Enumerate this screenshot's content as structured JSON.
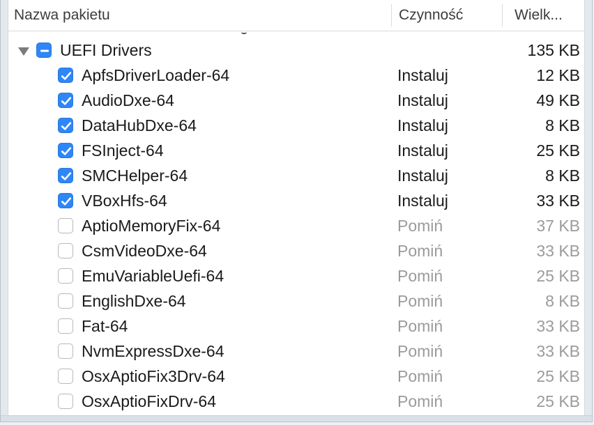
{
  "header": {
    "col_name": "Nazwa pakietu",
    "col_action": "Czynność",
    "col_size": "Wielk..."
  },
  "group": {
    "name": "UEFI Drivers",
    "size": "135 KB",
    "state": "mixed"
  },
  "items": [
    {
      "name": "ApfsDriverLoader-64",
      "action": "Instaluj",
      "size": "12 KB",
      "checked": true
    },
    {
      "name": "AudioDxe-64",
      "action": "Instaluj",
      "size": "49 KB",
      "checked": true
    },
    {
      "name": "DataHubDxe-64",
      "action": "Instaluj",
      "size": "8 KB",
      "checked": true
    },
    {
      "name": "FSInject-64",
      "action": "Instaluj",
      "size": "25 KB",
      "checked": true
    },
    {
      "name": "SMCHelper-64",
      "action": "Instaluj",
      "size": "8 KB",
      "checked": true
    },
    {
      "name": "VBoxHfs-64",
      "action": "Instaluj",
      "size": "33 KB",
      "checked": true
    },
    {
      "name": "AptioMemoryFix-64",
      "action": "Pomiń",
      "size": "37 KB",
      "checked": false
    },
    {
      "name": "CsmVideoDxe-64",
      "action": "Pomiń",
      "size": "33 KB",
      "checked": false
    },
    {
      "name": "EmuVariableUefi-64",
      "action": "Pomiń",
      "size": "25 KB",
      "checked": false
    },
    {
      "name": "EnglishDxe-64",
      "action": "Pomiń",
      "size": "8 KB",
      "checked": false
    },
    {
      "name": "Fat-64",
      "action": "Pomiń",
      "size": "33 KB",
      "checked": false
    },
    {
      "name": "NvmExpressDxe-64",
      "action": "Pomiń",
      "size": "33 KB",
      "checked": false
    },
    {
      "name": "OsxAptioFix3Drv-64",
      "action": "Pomiń",
      "size": "25 KB",
      "checked": false
    },
    {
      "name": "OsxAptioFixDrv-64",
      "action": "Pomiń",
      "size": "25 KB",
      "checked": false
    }
  ],
  "colors": {
    "checkbox_blue": "#2f86f6",
    "skip_text": "#9b9b9b"
  }
}
